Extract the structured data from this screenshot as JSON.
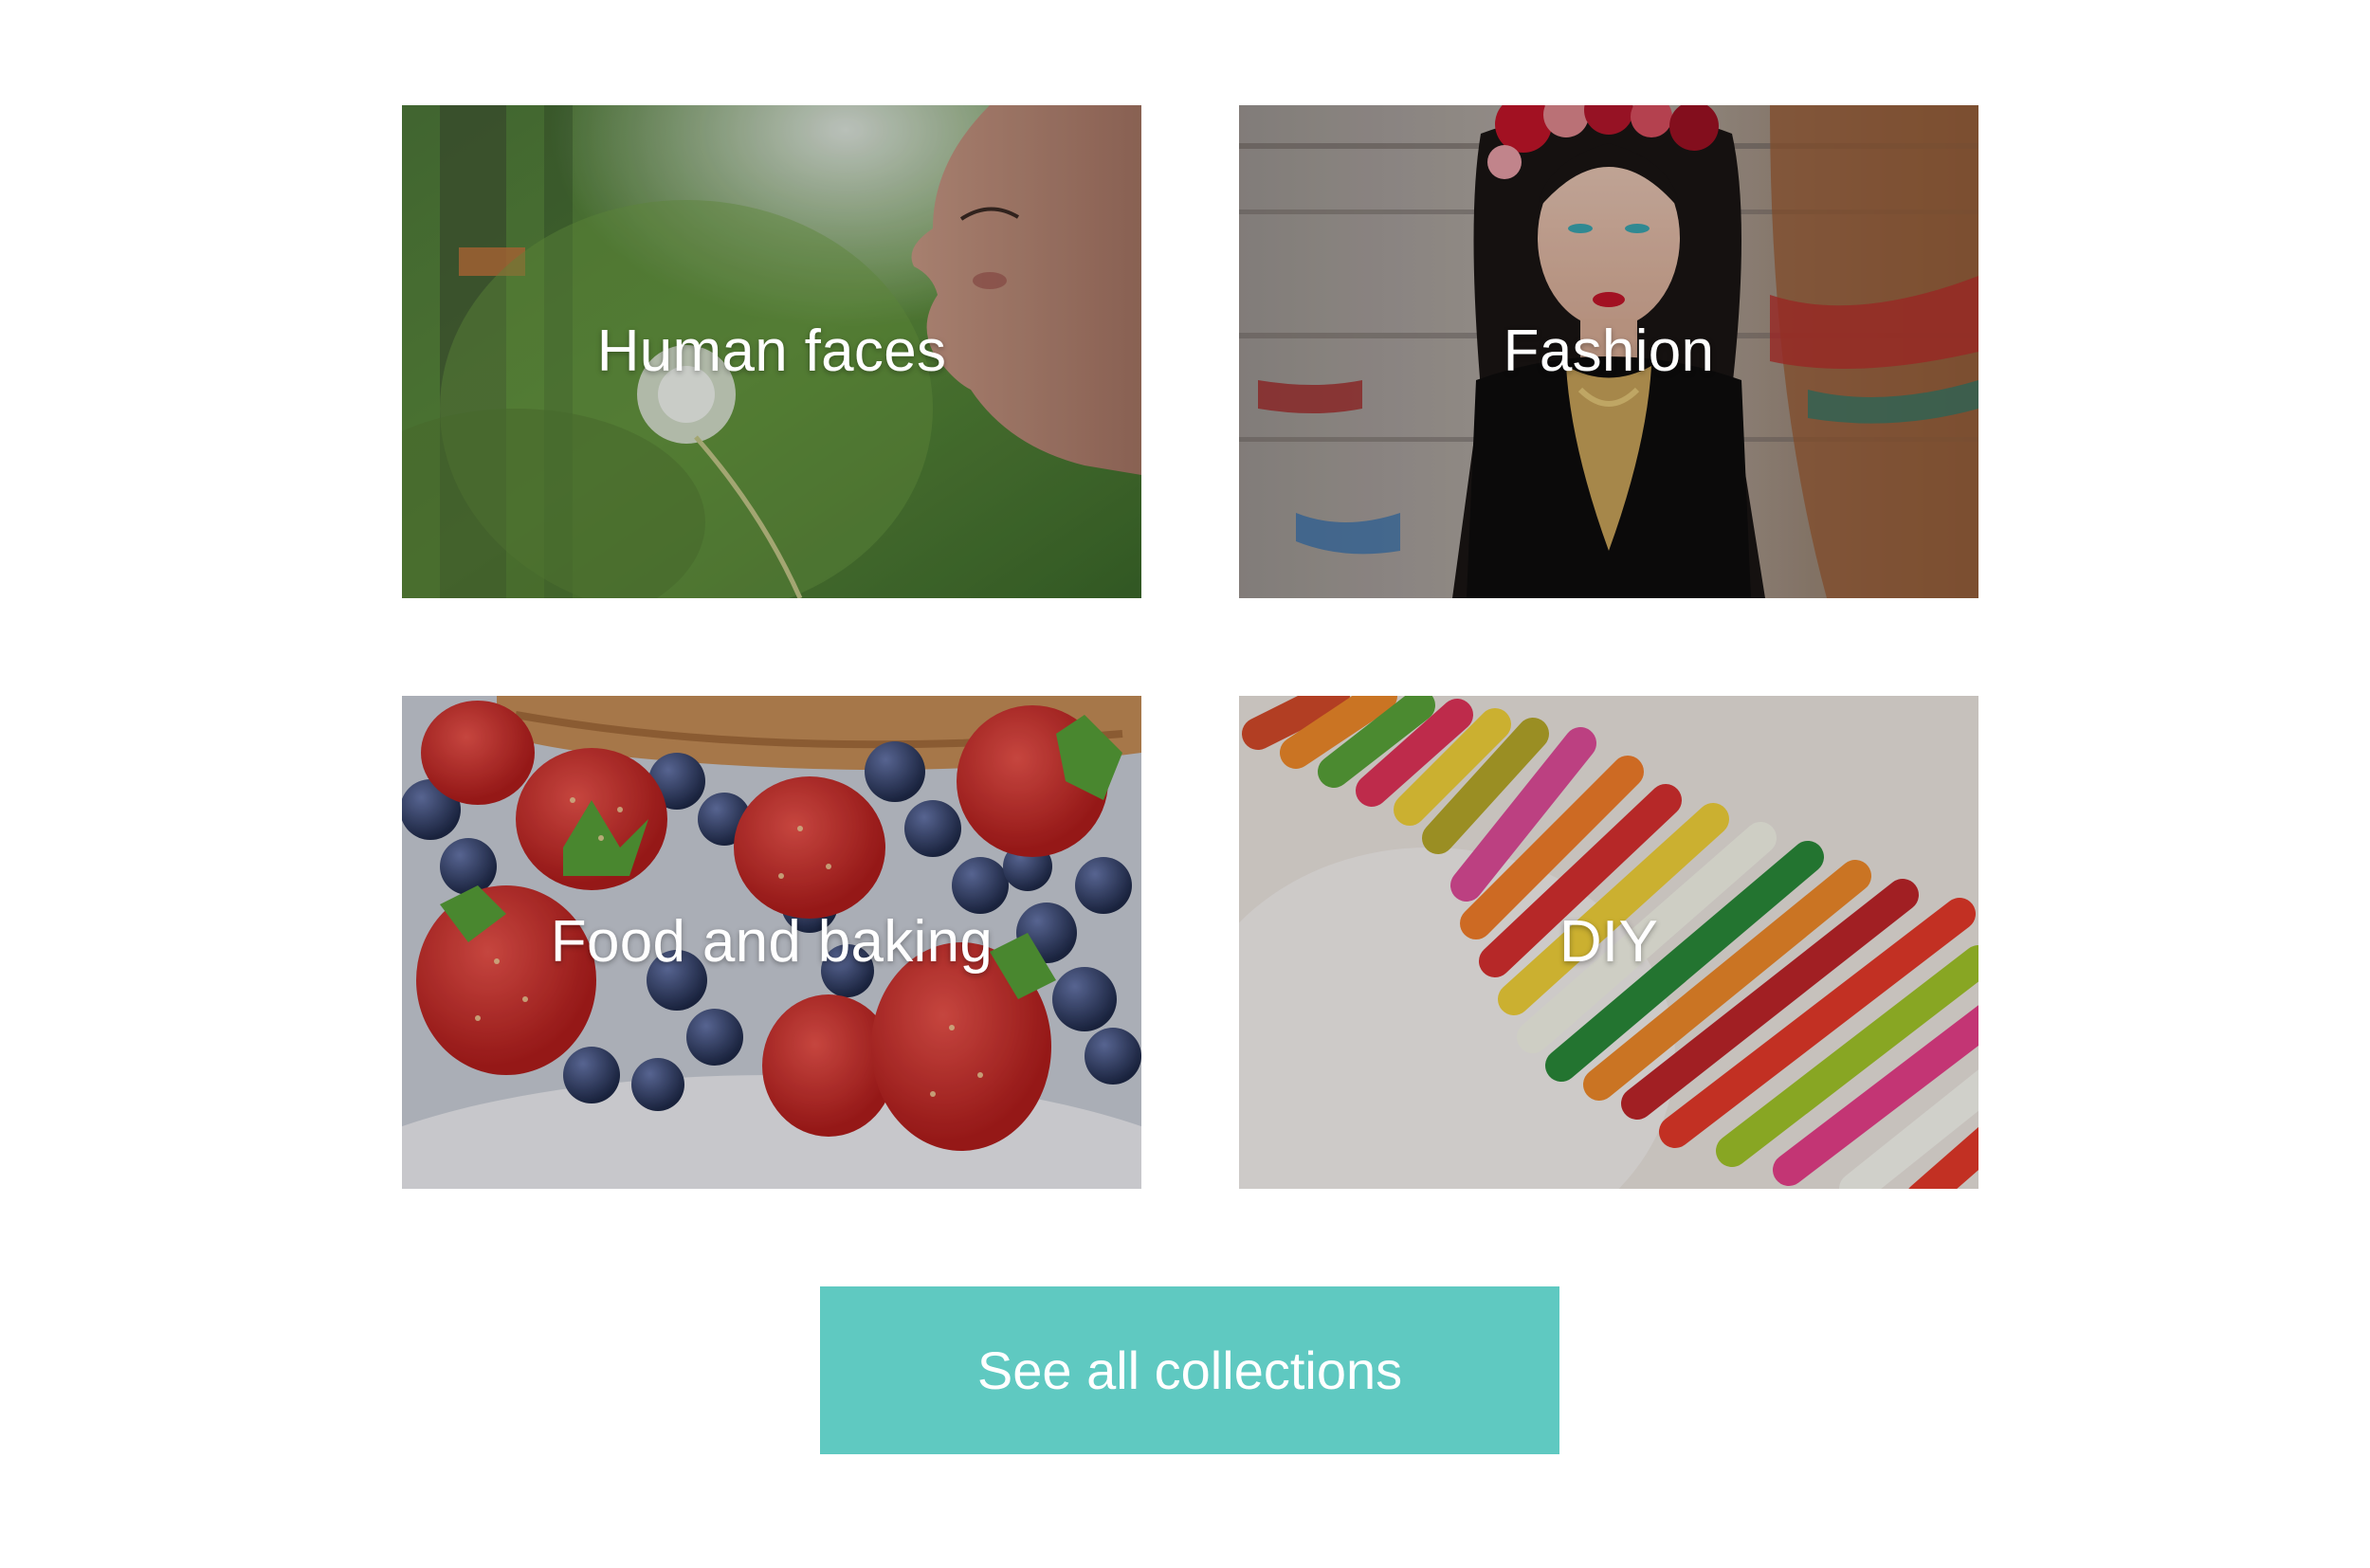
{
  "collections": [
    {
      "label": "Human faces"
    },
    {
      "label": "Fashion"
    },
    {
      "label": "Food and baking"
    },
    {
      "label": "DIY"
    }
  ],
  "cta": {
    "label": "See all collections"
  },
  "colors": {
    "accent": "#5fc9c1",
    "label_text": "#ffffff",
    "background": "#ffffff"
  }
}
